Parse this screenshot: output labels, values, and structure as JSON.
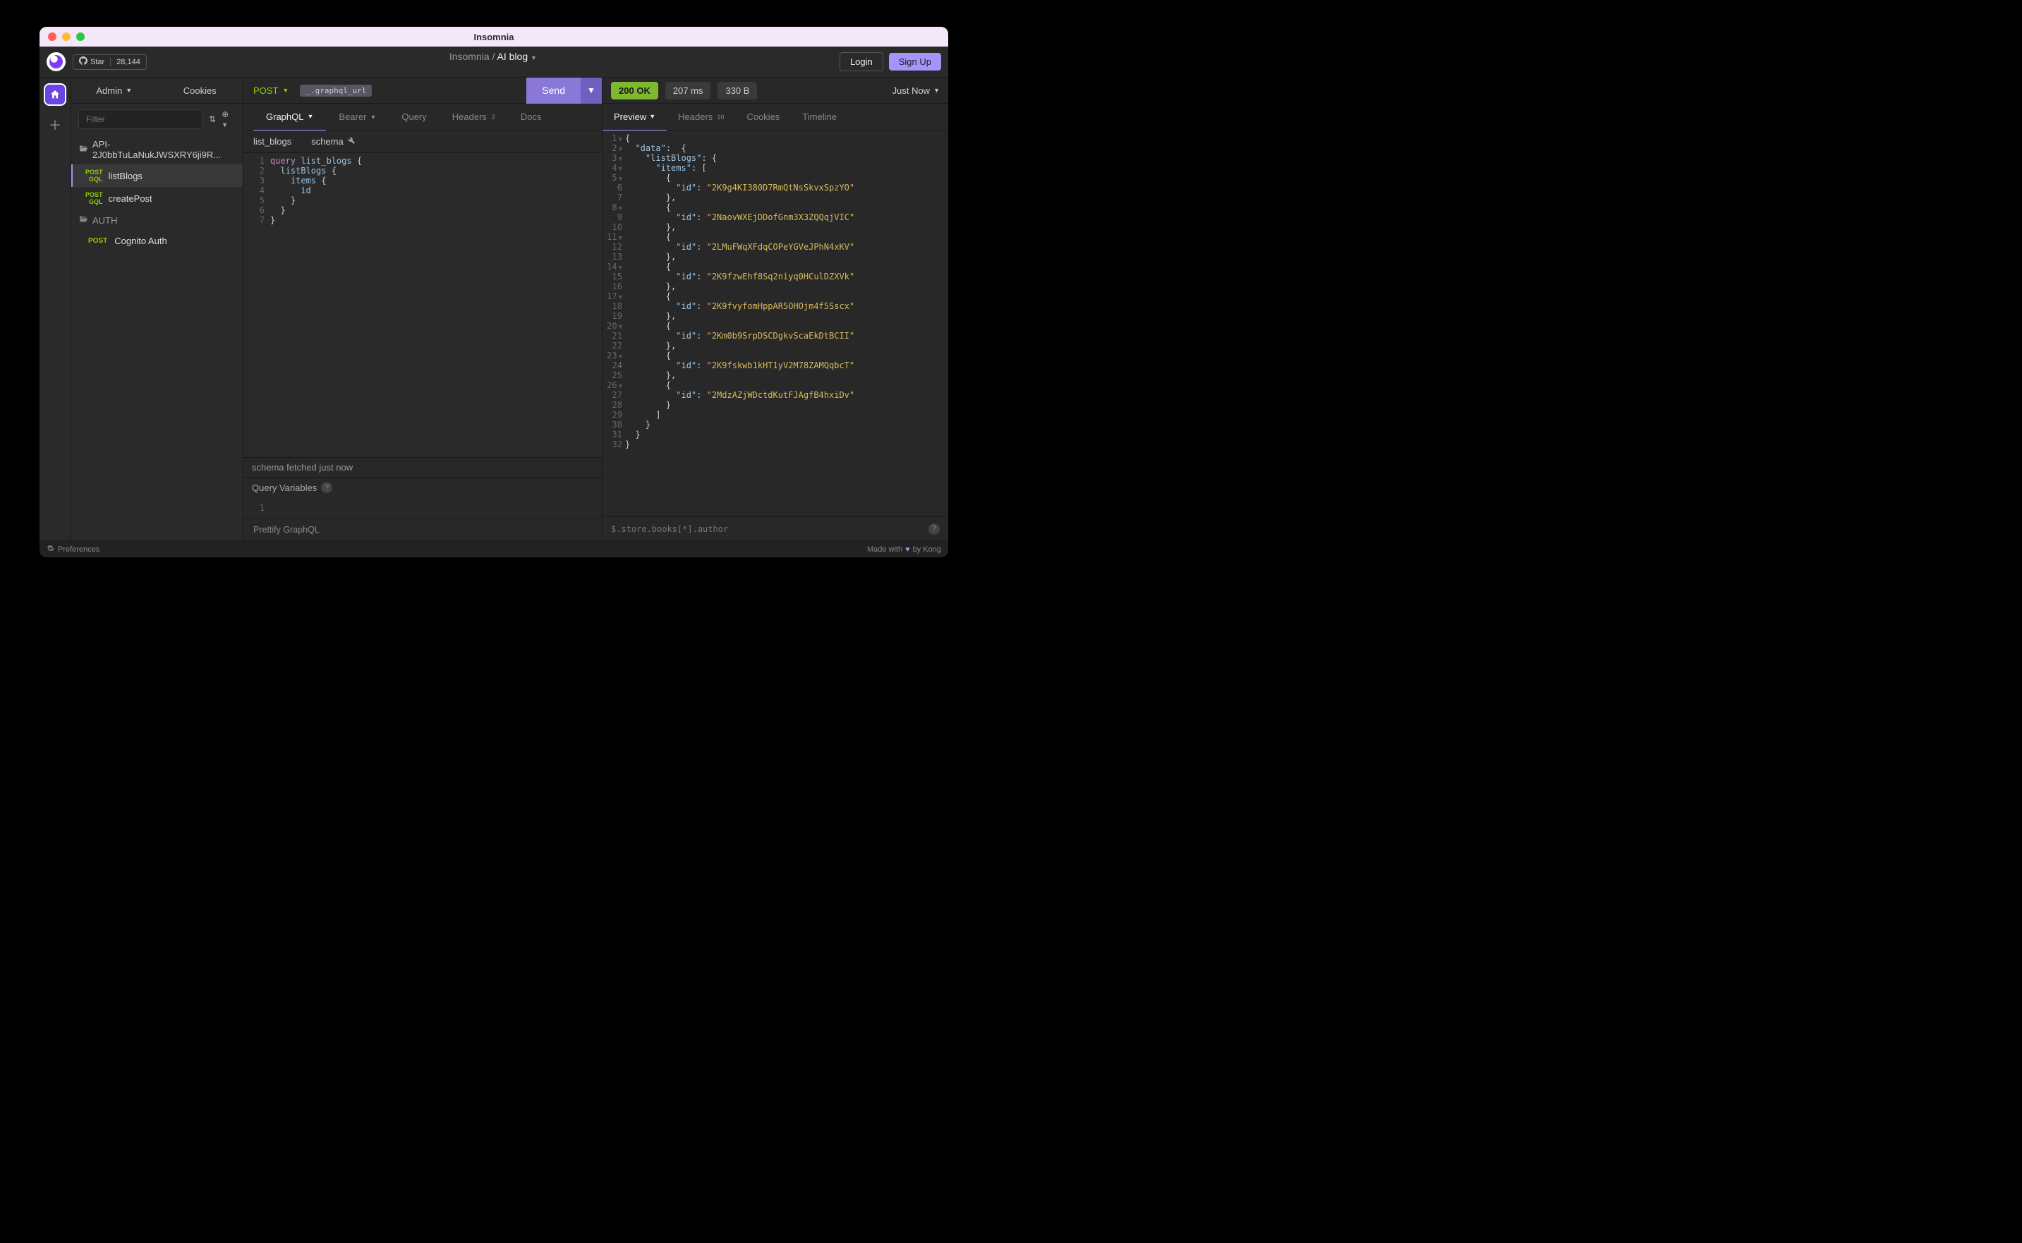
{
  "window": {
    "title": "Insomnia"
  },
  "github": {
    "star_label": "Star",
    "star_count": "28,144"
  },
  "breadcrumb": {
    "root": "Insomnia",
    "sep": "/",
    "workspace": "AI blog"
  },
  "auth_buttons": {
    "login": "Login",
    "signup": "Sign Up"
  },
  "sidebar": {
    "tabs": {
      "admin": "Admin",
      "cookies": "Cookies"
    },
    "filter_placeholder": "Filter",
    "folder": "API-2J0bbTuLaNukJWSXRY6ji9R...",
    "items": [
      {
        "method": "POST",
        "sub": "GQL",
        "name": "listBlogs",
        "active": true
      },
      {
        "method": "POST",
        "sub": "GQL",
        "name": "createPost",
        "active": false
      }
    ],
    "auth_folder": "AUTH",
    "cognito": {
      "method": "POST",
      "name": "Cognito Auth"
    }
  },
  "request": {
    "method": "POST",
    "url_chip": "_.graphql_url",
    "send": "Send",
    "tabs": {
      "graphql": "GraphQL",
      "bearer": "Bearer",
      "query": "Query",
      "headers": "Headers",
      "headers_badge": "2",
      "docs": "Docs"
    },
    "subtabs": {
      "list_blogs": "list_blogs",
      "schema": "schema"
    },
    "code_lines": [
      {
        "n": 1,
        "html": "<span class='tok-keyword'>query</span> <span class='tok-name'>list_blogs</span> <span class='tok-brace'>{</span>"
      },
      {
        "n": 2,
        "html": "  <span class='tok-name'>listBlogs</span> <span class='tok-brace'>{</span>"
      },
      {
        "n": 3,
        "html": "    <span class='tok-name'>items</span> <span class='tok-brace'>{</span>"
      },
      {
        "n": 4,
        "html": "      <span class='tok-name'>id</span>"
      },
      {
        "n": 5,
        "html": "    <span class='tok-brace'>}</span>"
      },
      {
        "n": 6,
        "html": "  <span class='tok-brace'>}</span>"
      },
      {
        "n": 7,
        "html": "<span class='tok-brace'>}</span>"
      }
    ],
    "schema_status": "schema fetched just now",
    "query_variables_label": "Query Variables",
    "prettify": "Prettify GraphQL"
  },
  "response": {
    "status_code": "200",
    "status_text": "OK",
    "time": "207 ms",
    "size": "330 B",
    "just_now": "Just Now",
    "tabs": {
      "preview": "Preview",
      "headers": "Headers",
      "headers_badge": "10",
      "cookies": "Cookies",
      "timeline": "Timeline"
    },
    "items_ids": [
      "2K9g4KI380D7RmQtNsSkvxSpzYO",
      "2NaovWXEjDDofGnm3X3ZQQqjVIC",
      "2LMuFWqXFdqCOPeYGVeJPhN4xKV",
      "2K9fzwEhf8Sq2niyq0HCulDZXVk",
      "2K9fvyfomHppAR5OHOjm4f5Sscx",
      "2Km0b9SrpDSCDgkvScaEkDtBCII",
      "2K9fskwb1kHT1yV2M78ZAMQqbcT",
      "2MdzAZjWDctdKutFJAgfB4hxiDv"
    ],
    "filter_placeholder": "$.store.books[*].author"
  },
  "footer": {
    "preferences": "Preferences",
    "made_with": "Made with",
    "by": "by Kong"
  }
}
